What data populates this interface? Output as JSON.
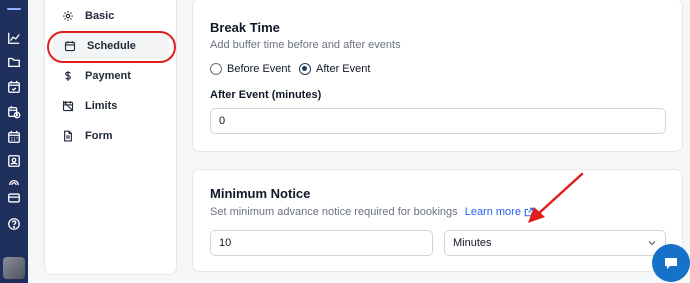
{
  "rail": {
    "icons": [
      "logo",
      "chart-line-icon",
      "folder-icon",
      "calendar-check-icon",
      "calendar-clock-icon",
      "calendar-icon",
      "contact-card-icon",
      "broadcast-icon",
      "credit-card-icon",
      "help-circle-icon",
      "avatar"
    ]
  },
  "subnav": {
    "items": [
      {
        "label": "Basic",
        "icon": "gear-icon"
      },
      {
        "label": "Schedule",
        "icon": "calendar-icon",
        "active": true
      },
      {
        "label": "Payment",
        "icon": "dollar-icon"
      },
      {
        "label": "Limits",
        "icon": "calendar-off-icon"
      },
      {
        "label": "Form",
        "icon": "document-icon"
      }
    ]
  },
  "break_time": {
    "title": "Break Time",
    "subtitle": "Add buffer time before and after events",
    "options": [
      {
        "label": "Before Event",
        "selected": false
      },
      {
        "label": "After Event",
        "selected": true
      }
    ],
    "field_label": "After Event (minutes)",
    "field_value": "0"
  },
  "minimum_notice": {
    "title": "Minimum Notice",
    "subtitle": "Set minimum advance notice required for bookings",
    "learn_more": "Learn more",
    "value": "10",
    "unit": "Minutes"
  },
  "colors": {
    "rail": "#1f2f5c",
    "annotation_red": "#e11d1d",
    "link": "#2563eb",
    "chat": "#1671c9"
  }
}
